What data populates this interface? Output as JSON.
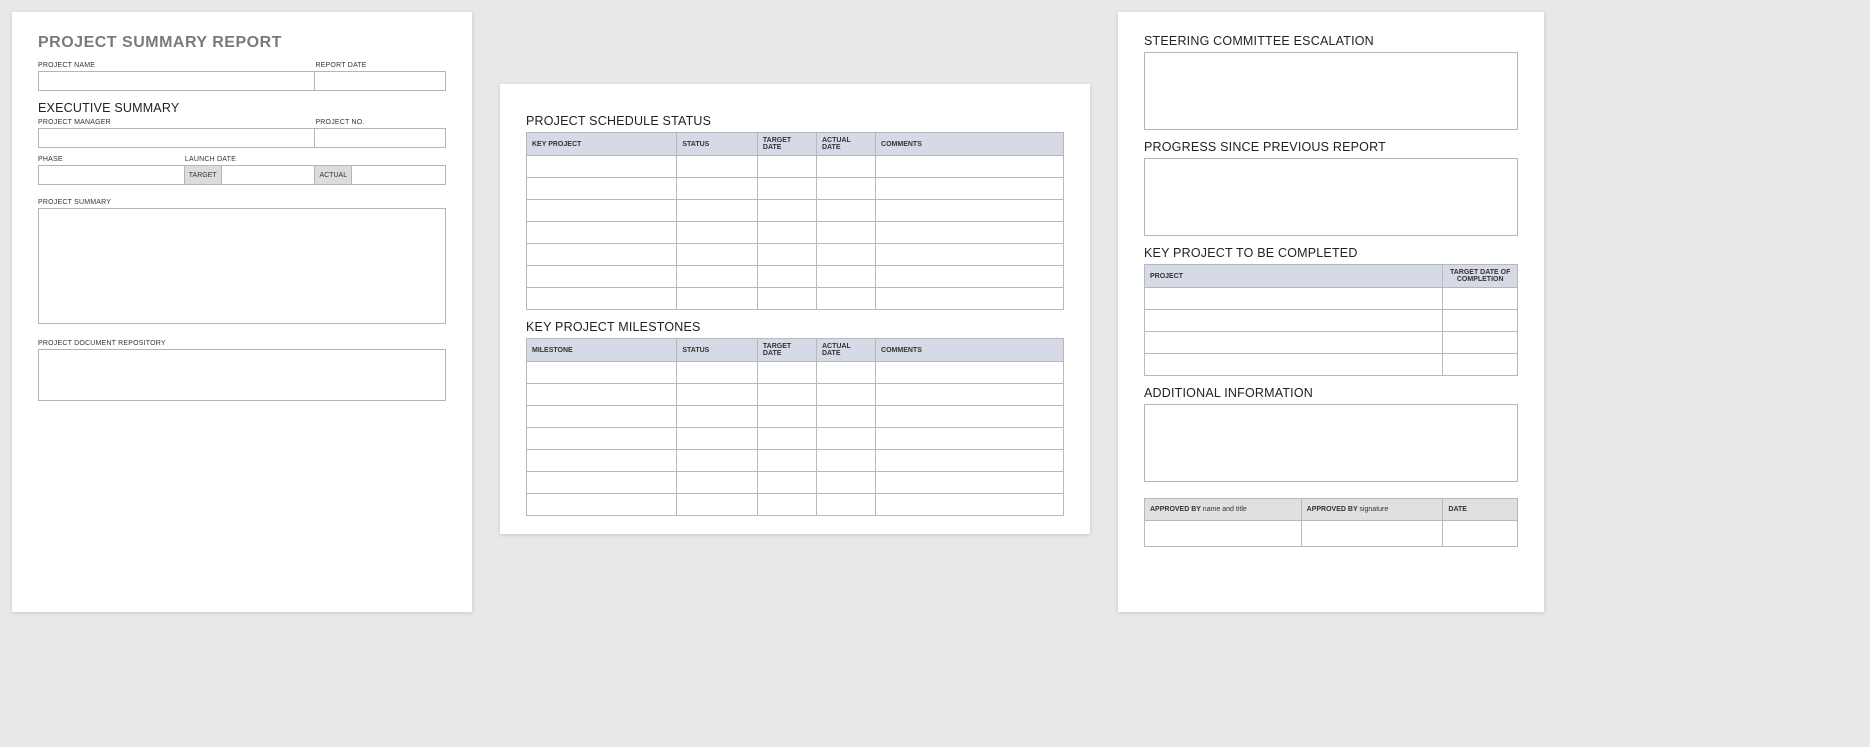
{
  "page1": {
    "title": "PROJECT SUMMARY REPORT",
    "labels": {
      "project_name": "PROJECT NAME",
      "report_date": "REPORT DATE",
      "executive_summary": "EXECUTIVE SUMMARY",
      "project_manager": "PROJECT MANAGER",
      "project_no": "PROJECT NO.",
      "phase": "PHASE",
      "launch_date": "LAUNCH DATE",
      "target": "TARGET",
      "actual": "ACTUAL",
      "project_summary": "PROJECT SUMMARY",
      "project_doc_repo": "PROJECT DOCUMENT REPOSITORY"
    }
  },
  "page2": {
    "schedule_heading": "PROJECT SCHEDULE STATUS",
    "schedule_headers": {
      "key_project": "KEY PROJECT",
      "status": "STATUS",
      "target_date": "TARGET DATE",
      "actual_date": "ACTUAL DATE",
      "comments": "COMMENTS"
    },
    "milestones_heading": "KEY PROJECT MILESTONES",
    "milestones_headers": {
      "milestone": "MILESTONE",
      "status": "STATUS",
      "target_date": "TARGET DATE",
      "actual_date": "ACTUAL DATE",
      "comments": "COMMENTS"
    }
  },
  "page3": {
    "steering_heading": "STEERING COMMITTEE ESCALATION",
    "progress_heading": "PROGRESS SINCE PREVIOUS REPORT",
    "key_project_heading": "KEY PROJECT TO BE COMPLETED",
    "key_project_headers": {
      "project": "PROJECT",
      "target_date": "TARGET DATE OF COMPLETION"
    },
    "additional_heading": "ADDITIONAL INFORMATION",
    "approval": {
      "approved_by_name": "APPROVED BY",
      "name_sub": "name and title",
      "approved_by_sig": "APPROVED BY",
      "sig_sub": "signature",
      "date": "DATE"
    }
  }
}
